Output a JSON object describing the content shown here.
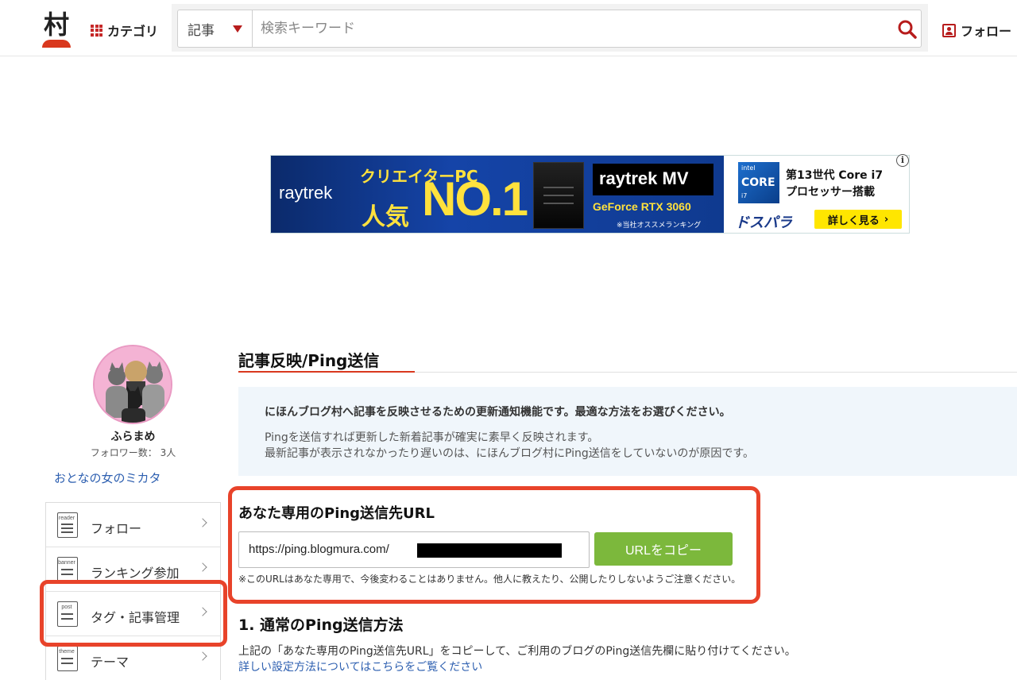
{
  "header": {
    "logo_char": "村",
    "category_label": "カテゴリ",
    "search_type": "記事",
    "search_placeholder": "検索キーワード",
    "follow_label": "フォロー"
  },
  "ad": {
    "brand": "raytrek",
    "headline": "クリエイターPC",
    "ninki": "人気",
    "rank": "NO.1",
    "model": "raytrek MV",
    "gpu": "GeForce RTX 3060",
    "note": "※当社オススメランキング",
    "intel_top": "intel",
    "intel_core": "CORE",
    "intel_tier": "i7",
    "cpu_gen": "第13世代 Core i7",
    "cpu_line2": "プロセッサー搭載",
    "shop": "ドスパラ",
    "more_label": "詳しく見る",
    "more_arrow": "›",
    "info_glyph": "i"
  },
  "sidebar": {
    "username": "ふらまめ",
    "followers": "フォロワー数： 3人",
    "blog_name": "おとなの女のミカタ",
    "menu": [
      {
        "tag": "reader",
        "label": "フォロー"
      },
      {
        "tag": "banner",
        "label": "ランキング参加"
      },
      {
        "tag": "post",
        "label": "タグ・記事管理"
      },
      {
        "tag": "theme",
        "label": "テーマ"
      }
    ]
  },
  "main": {
    "title": "記事反映/Ping送信",
    "info_lead": "にほんブログ村へ記事を反映させるための更新通知機能です。最適な方法をお選びください。",
    "info_line1": "Pingを送信すれば更新した新着記事が確実に素早く反映されます。",
    "info_line2": "最新記事が表示されなかったり遅いのは、にほんブログ村にPing送信をしていないのが原因です。",
    "ping_title": "あなた専用のPing送信先URL",
    "url_prefix": "https://ping.blogmura.com/",
    "copy_label": "URLをコピー",
    "url_note": "※このURLはあなた専用で、今後変わることはありません。他人に教えたり、公開したりしないようご注意ください。",
    "step1_title": "1. 通常のPing送信方法",
    "step1_desc": "上記の「あなた専用のPing送信先URL」をコピーして、ご利用のブログのPing送信先欄に貼り付けてください。",
    "step1_link": "詳しい設定方法についてはこちらをご覧ください"
  },
  "colors": {
    "accent_red": "#d9381e",
    "highlight_box": "#e8432a",
    "copy_button": "#7cb83c",
    "link_blue": "#2d5fb0",
    "info_bg": "#f0f6fb"
  }
}
